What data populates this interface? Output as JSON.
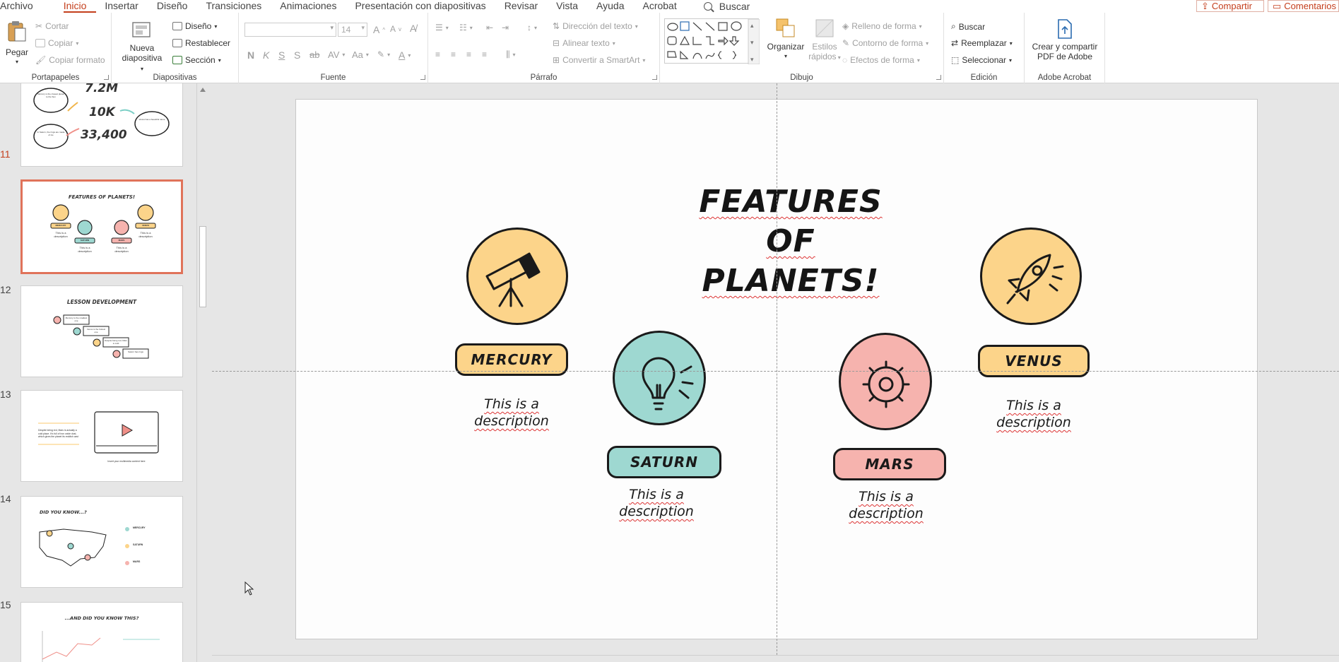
{
  "menu": {
    "tabs": [
      "Archivo",
      "Inicio",
      "Insertar",
      "Diseño",
      "Transiciones",
      "Animaciones",
      "Presentación con diapositivas",
      "Revisar",
      "Vista",
      "Ayuda",
      "Acrobat"
    ],
    "active": "Inicio",
    "search": "Buscar",
    "share": "Compartir",
    "comments": "Comentarios"
  },
  "ribbon": {
    "clipboard": {
      "label": "Portapapeles",
      "paste": "Pegar",
      "cut": "Cortar",
      "copy": "Copiar",
      "format": "Copiar formato"
    },
    "slides": {
      "label": "Diapositivas",
      "new_line1": "Nueva",
      "new_line2": "diapositiva",
      "layout": "Diseño",
      "reset": "Restablecer",
      "section": "Sección"
    },
    "font": {
      "label": "Fuente",
      "name": "",
      "size": "14",
      "bold": "N",
      "italic": "K",
      "underline": "S",
      "shadow": "S",
      "strike": "ab",
      "spacing": "AV",
      "case": "Aa"
    },
    "paragraph": {
      "label": "Párrafo",
      "direction": "Dirección del texto",
      "align": "Alinear texto",
      "smartart": "Convertir a SmartArt"
    },
    "drawing": {
      "label": "Dibujo",
      "arrange": "Organizar",
      "styles_line1": "Estilos",
      "styles_line2": "rápidos",
      "fill": "Relleno de forma",
      "outline": "Contorno de forma",
      "effects": "Efectos de forma"
    },
    "editing": {
      "label": "Edición",
      "find": "Buscar",
      "replace": "Reemplazar",
      "select": "Seleccionar"
    },
    "acrobat": {
      "label": "Adobe Acrobat",
      "create_line1": "Crear y compartir",
      "create_line2": "PDF de Adobe"
    }
  },
  "thumbnails": [
    {
      "number": "",
      "stats": [
        "7.2M",
        "10K",
        "33,400"
      ],
      "bubbles": [
        "Mercury is the closest planet to the Sun",
        "Venus has a beautiful name",
        "In Saturn, the rings are made of ice"
      ]
    },
    {
      "number": "11",
      "title": "Features of planets!",
      "labels": [
        "Mercury",
        "Saturn",
        "Mars",
        "Venus"
      ],
      "desc": "This is a description"
    },
    {
      "number": "12",
      "title": "Lesson development",
      "items": [
        "Mercury is the smallest one",
        "Venus is the hottest one",
        "Despite being red, Mars is cold",
        "Saturn has rings"
      ]
    },
    {
      "number": "13",
      "text": "Despite being red, Mars is actually a cold place. It's full of iron oxide dust, which gives the planet its reddish cast",
      "caption": "Insert your multimedia content here"
    },
    {
      "number": "14",
      "title": "Did you know...?",
      "labels": [
        "Mercury",
        "Saturn",
        "Mars"
      ]
    },
    {
      "number": "15",
      "title": "...and did you know this?"
    }
  ],
  "slide": {
    "title": "Features of planets!",
    "planets": [
      {
        "name": "Mercury",
        "desc": "This is a description",
        "icon": "telescope-icon",
        "color": "#fcd48a"
      },
      {
        "name": "Saturn",
        "desc": "This is a description",
        "icon": "lightbulb-icon",
        "color": "#9ed8d1"
      },
      {
        "name": "Mars",
        "desc": "This is a description",
        "icon": "gear-icon",
        "color": "#f6b3ae"
      },
      {
        "name": "Venus",
        "desc": "This is a description",
        "icon": "rocket-icon",
        "color": "#fcd48a"
      }
    ]
  }
}
